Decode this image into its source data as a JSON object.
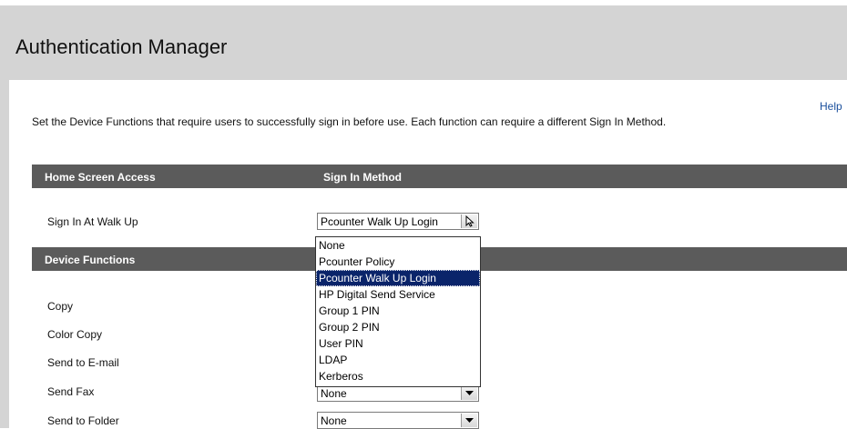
{
  "header": {
    "title": "Authentication Manager"
  },
  "help_label": "Help",
  "description": "Set the Device Functions that require users to successfully sign in before use. Each function can require a different Sign In Method.",
  "home_section": {
    "col1": "Home Screen Access",
    "col2": "Sign In Method",
    "row_label": "Sign In At Walk Up",
    "selected_value": "Pcounter Walk Up Login"
  },
  "device_section": {
    "title": "Device Functions"
  },
  "functions": [
    {
      "label": "Copy"
    },
    {
      "label": "Color Copy"
    },
    {
      "label": "Send to E-mail"
    },
    {
      "label": "Send Fax",
      "value": "None"
    },
    {
      "label": "Send to Folder",
      "value": "None"
    }
  ],
  "dropdown_options": [
    "None",
    "Pcounter Policy",
    "Pcounter Walk Up Login",
    "HP Digital Send Service",
    "Group 1 PIN",
    "Group 2 PIN",
    "User PIN",
    "LDAP",
    "Kerberos"
  ],
  "dropdown_selected_index": 2,
  "colors": {
    "header_bg": "#d4d4d4",
    "section_bar": "#5b5b5b",
    "selection": "#0a246a",
    "link": "#1a4f9c"
  }
}
